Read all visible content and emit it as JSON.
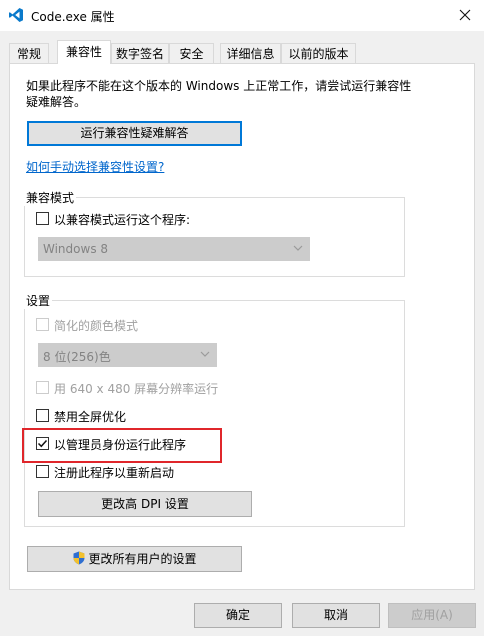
{
  "window": {
    "title": "Code.exe 属性",
    "icon": "vscode-icon",
    "close_icon": "close-icon"
  },
  "tabs": [
    {
      "label": "常规",
      "active": false
    },
    {
      "label": "兼容性",
      "active": true
    },
    {
      "label": "数字签名",
      "active": false
    },
    {
      "label": "安全",
      "active": false
    },
    {
      "label": "详细信息",
      "active": false
    },
    {
      "label": "以前的版本",
      "active": false
    }
  ],
  "compat": {
    "description": "如果此程序不能在这个版本的 Windows 上正常工作，请尝试运行兼容性疑难解答。",
    "troubleshoot_button": "运行兼容性疑难解答",
    "manual_link": "如何手动选择兼容性设置?",
    "mode_group": {
      "label": "兼容模式",
      "checkbox_label": "以兼容模式运行这个程序:",
      "checked": false,
      "select_value": "Windows 8"
    },
    "settings_group": {
      "label": "设置",
      "reduced_color": {
        "label": "简化的颜色模式",
        "checked": false,
        "enabled": false
      },
      "color_select": "8 位(256)色",
      "res_640": {
        "label": "用 640 x 480 屏幕分辨率运行",
        "checked": false,
        "enabled": false
      },
      "disable_fullscreen": {
        "label": "禁用全屏优化",
        "checked": false,
        "enabled": true
      },
      "run_as_admin": {
        "label": "以管理员身份运行此程序",
        "checked": true,
        "enabled": true
      },
      "register_restart": {
        "label": "注册此程序以重新启动",
        "checked": false,
        "enabled": true
      },
      "dpi_button": "更改高 DPI 设置"
    },
    "all_users_button": "更改所有用户的设置"
  },
  "footer": {
    "ok": "确定",
    "cancel": "取消",
    "apply": "应用(A)"
  },
  "colors": {
    "accent": "#0078d7",
    "highlight": "#e0262b",
    "link": "#0066cc"
  }
}
